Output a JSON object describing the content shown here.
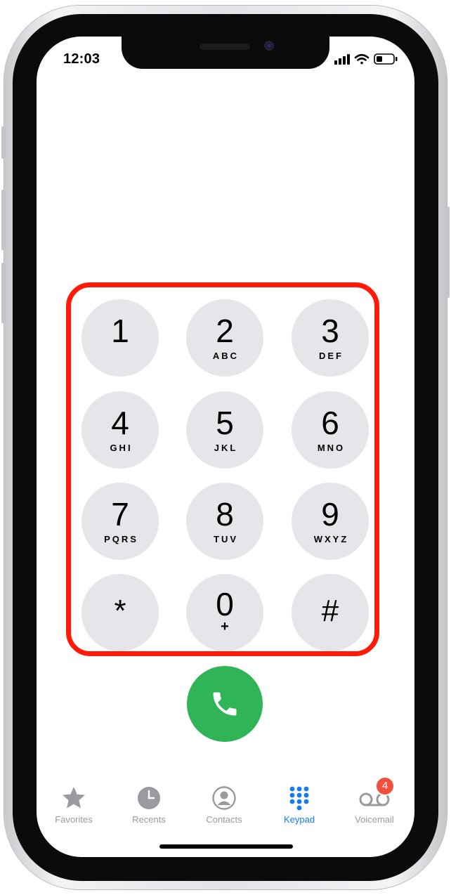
{
  "status_bar": {
    "time": "12:03"
  },
  "keypad": {
    "keys": [
      {
        "digit": "1",
        "letters": ""
      },
      {
        "digit": "2",
        "letters": "ABC"
      },
      {
        "digit": "3",
        "letters": "DEF"
      },
      {
        "digit": "4",
        "letters": "GHI"
      },
      {
        "digit": "5",
        "letters": "JKL"
      },
      {
        "digit": "6",
        "letters": "MNO"
      },
      {
        "digit": "7",
        "letters": "PQRS"
      },
      {
        "digit": "8",
        "letters": "TUV"
      },
      {
        "digit": "9",
        "letters": "WXYZ"
      },
      {
        "digit": "*",
        "letters": ""
      },
      {
        "digit": "0",
        "letters": "+"
      },
      {
        "digit": "#",
        "letters": ""
      }
    ]
  },
  "tabbar": {
    "tabs": [
      {
        "label": "Favorites",
        "icon": "star-icon",
        "active": false
      },
      {
        "label": "Recents",
        "icon": "clock-icon",
        "active": false
      },
      {
        "label": "Contacts",
        "icon": "contact-icon",
        "active": false
      },
      {
        "label": "Keypad",
        "icon": "keypad-icon",
        "active": true
      },
      {
        "label": "Voicemail",
        "icon": "voicemail-icon",
        "active": false,
        "badge": "4"
      }
    ]
  },
  "colors": {
    "call_green": "#2fb457",
    "active_blue": "#1479f4",
    "inactive_gray": "#9a9a9f",
    "key_gray": "#e5e5ea",
    "highlight_red": "#ff1a0a",
    "badge_red": "#f0503c"
  }
}
